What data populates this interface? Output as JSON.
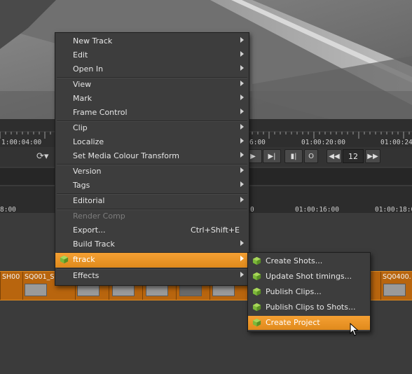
{
  "ruler_top": {
    "timecodes": [
      "1:00:04:00",
      "6:00",
      "01:00:20:00",
      "01:00:24:"
    ]
  },
  "transport": {
    "loop_icon": "cycle-icon",
    "frame_step_value": "12",
    "button_o_label": "O"
  },
  "ruler_timeline": {
    "timecodes": [
      "8:00",
      "0",
      "01:00:16:00",
      "01:00:18:00"
    ]
  },
  "clips": {
    "labels": [
      "SH00",
      "SQ001_S",
      "SQ0400."
    ]
  },
  "context_menu": {
    "items": [
      {
        "label": "New Track",
        "submenu": true
      },
      {
        "label": "Edit",
        "submenu": true
      },
      {
        "label": "Open In",
        "submenu": true
      },
      {
        "label": "View",
        "submenu": true
      },
      {
        "label": "Mark",
        "submenu": true
      },
      {
        "label": "Frame Control",
        "submenu": true
      },
      {
        "label": "Clip",
        "submenu": true
      },
      {
        "label": "Localize",
        "submenu": true
      },
      {
        "label": "Set Media Colour Transform",
        "submenu": true
      },
      {
        "label": "Version",
        "submenu": true
      },
      {
        "label": "Tags",
        "submenu": true
      },
      {
        "label": "Editorial",
        "submenu": true
      },
      {
        "label": "Render Comp",
        "disabled": true
      },
      {
        "label": "Export...",
        "shortcut": "Ctrl+Shift+E"
      },
      {
        "label": "Build Track",
        "submenu": true
      },
      {
        "label": "ftrack",
        "submenu": true,
        "highlighted": true,
        "icon": "ftrack-icon"
      },
      {
        "label": "Effects",
        "submenu": true
      }
    ]
  },
  "ftrack_submenu": {
    "items": [
      {
        "label": "Create Shots...",
        "icon": "ftrack-icon"
      },
      {
        "label": "Update Shot timings...",
        "icon": "ftrack-icon"
      },
      {
        "label": "Publish Clips...",
        "icon": "ftrack-icon"
      },
      {
        "label": "Publish Clips to Shots...",
        "icon": "ftrack-icon"
      },
      {
        "label": "Create Project",
        "icon": "ftrack-icon",
        "highlighted": true
      }
    ]
  },
  "colors": {
    "menu_bg": "#3d3d3d",
    "highlight": "#f0961f",
    "clip_track": "#b8650e",
    "ftrack_green": "#8bc34a"
  }
}
